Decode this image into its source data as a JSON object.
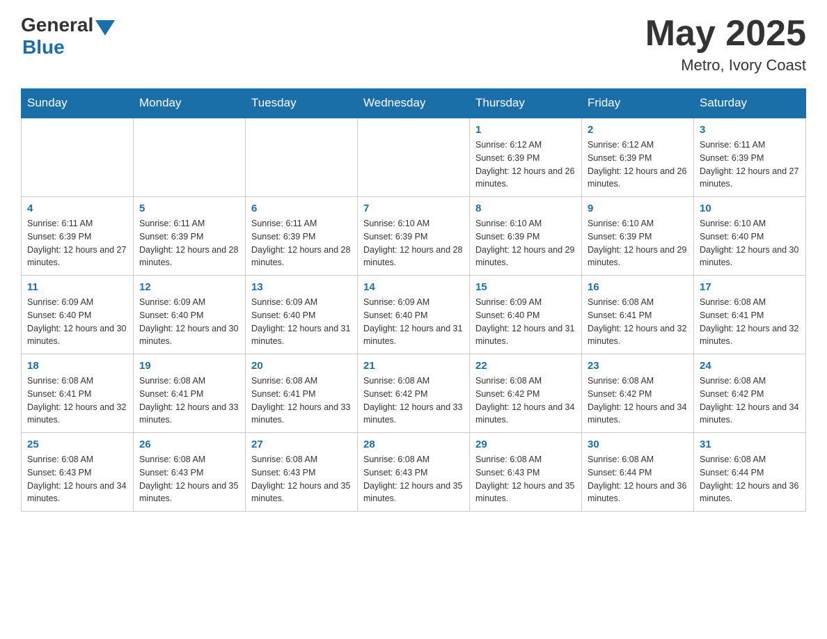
{
  "header": {
    "logo_general": "General",
    "logo_blue": "Blue",
    "month_title": "May 2025",
    "location": "Metro, Ivory Coast"
  },
  "days_of_week": [
    "Sunday",
    "Monday",
    "Tuesday",
    "Wednesday",
    "Thursday",
    "Friday",
    "Saturday"
  ],
  "weeks": [
    [
      {
        "day": "",
        "info": ""
      },
      {
        "day": "",
        "info": ""
      },
      {
        "day": "",
        "info": ""
      },
      {
        "day": "",
        "info": ""
      },
      {
        "day": "1",
        "info": "Sunrise: 6:12 AM\nSunset: 6:39 PM\nDaylight: 12 hours and 26 minutes."
      },
      {
        "day": "2",
        "info": "Sunrise: 6:12 AM\nSunset: 6:39 PM\nDaylight: 12 hours and 26 minutes."
      },
      {
        "day": "3",
        "info": "Sunrise: 6:11 AM\nSunset: 6:39 PM\nDaylight: 12 hours and 27 minutes."
      }
    ],
    [
      {
        "day": "4",
        "info": "Sunrise: 6:11 AM\nSunset: 6:39 PM\nDaylight: 12 hours and 27 minutes."
      },
      {
        "day": "5",
        "info": "Sunrise: 6:11 AM\nSunset: 6:39 PM\nDaylight: 12 hours and 28 minutes."
      },
      {
        "day": "6",
        "info": "Sunrise: 6:11 AM\nSunset: 6:39 PM\nDaylight: 12 hours and 28 minutes."
      },
      {
        "day": "7",
        "info": "Sunrise: 6:10 AM\nSunset: 6:39 PM\nDaylight: 12 hours and 28 minutes."
      },
      {
        "day": "8",
        "info": "Sunrise: 6:10 AM\nSunset: 6:39 PM\nDaylight: 12 hours and 29 minutes."
      },
      {
        "day": "9",
        "info": "Sunrise: 6:10 AM\nSunset: 6:39 PM\nDaylight: 12 hours and 29 minutes."
      },
      {
        "day": "10",
        "info": "Sunrise: 6:10 AM\nSunset: 6:40 PM\nDaylight: 12 hours and 30 minutes."
      }
    ],
    [
      {
        "day": "11",
        "info": "Sunrise: 6:09 AM\nSunset: 6:40 PM\nDaylight: 12 hours and 30 minutes."
      },
      {
        "day": "12",
        "info": "Sunrise: 6:09 AM\nSunset: 6:40 PM\nDaylight: 12 hours and 30 minutes."
      },
      {
        "day": "13",
        "info": "Sunrise: 6:09 AM\nSunset: 6:40 PM\nDaylight: 12 hours and 31 minutes."
      },
      {
        "day": "14",
        "info": "Sunrise: 6:09 AM\nSunset: 6:40 PM\nDaylight: 12 hours and 31 minutes."
      },
      {
        "day": "15",
        "info": "Sunrise: 6:09 AM\nSunset: 6:40 PM\nDaylight: 12 hours and 31 minutes."
      },
      {
        "day": "16",
        "info": "Sunrise: 6:08 AM\nSunset: 6:41 PM\nDaylight: 12 hours and 32 minutes."
      },
      {
        "day": "17",
        "info": "Sunrise: 6:08 AM\nSunset: 6:41 PM\nDaylight: 12 hours and 32 minutes."
      }
    ],
    [
      {
        "day": "18",
        "info": "Sunrise: 6:08 AM\nSunset: 6:41 PM\nDaylight: 12 hours and 32 minutes."
      },
      {
        "day": "19",
        "info": "Sunrise: 6:08 AM\nSunset: 6:41 PM\nDaylight: 12 hours and 33 minutes."
      },
      {
        "day": "20",
        "info": "Sunrise: 6:08 AM\nSunset: 6:41 PM\nDaylight: 12 hours and 33 minutes."
      },
      {
        "day": "21",
        "info": "Sunrise: 6:08 AM\nSunset: 6:42 PM\nDaylight: 12 hours and 33 minutes."
      },
      {
        "day": "22",
        "info": "Sunrise: 6:08 AM\nSunset: 6:42 PM\nDaylight: 12 hours and 34 minutes."
      },
      {
        "day": "23",
        "info": "Sunrise: 6:08 AM\nSunset: 6:42 PM\nDaylight: 12 hours and 34 minutes."
      },
      {
        "day": "24",
        "info": "Sunrise: 6:08 AM\nSunset: 6:42 PM\nDaylight: 12 hours and 34 minutes."
      }
    ],
    [
      {
        "day": "25",
        "info": "Sunrise: 6:08 AM\nSunset: 6:43 PM\nDaylight: 12 hours and 34 minutes."
      },
      {
        "day": "26",
        "info": "Sunrise: 6:08 AM\nSunset: 6:43 PM\nDaylight: 12 hours and 35 minutes."
      },
      {
        "day": "27",
        "info": "Sunrise: 6:08 AM\nSunset: 6:43 PM\nDaylight: 12 hours and 35 minutes."
      },
      {
        "day": "28",
        "info": "Sunrise: 6:08 AM\nSunset: 6:43 PM\nDaylight: 12 hours and 35 minutes."
      },
      {
        "day": "29",
        "info": "Sunrise: 6:08 AM\nSunset: 6:43 PM\nDaylight: 12 hours and 35 minutes."
      },
      {
        "day": "30",
        "info": "Sunrise: 6:08 AM\nSunset: 6:44 PM\nDaylight: 12 hours and 36 minutes."
      },
      {
        "day": "31",
        "info": "Sunrise: 6:08 AM\nSunset: 6:44 PM\nDaylight: 12 hours and 36 minutes."
      }
    ]
  ]
}
